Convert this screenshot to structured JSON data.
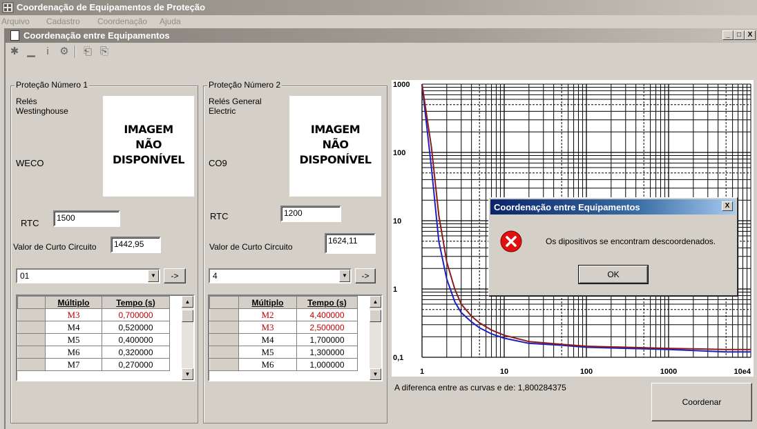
{
  "app": {
    "title": "Coordenação de Equipamentos de Proteção"
  },
  "menu": [
    "Arquivo",
    "Cadastro",
    "Coordenação",
    "Ajuda"
  ],
  "child": {
    "title": "Coordenação entre Equipamentos",
    "buttons": [
      "_",
      "□",
      "X"
    ]
  },
  "protection1": {
    "legend": "Proteção Número 1",
    "manufacturer": "Relés Westinghouse",
    "model": "WECO",
    "image_text_line1": "IMAGEM",
    "image_text_line2": "NÃO DISPONÍVEL",
    "rtc_label": "RTC",
    "rtc_value": "1500",
    "short_circuit_label": "Valor de Curto Circuito",
    "short_circuit_value": "1442,95",
    "combo_value": "01",
    "go_button": "->",
    "table": {
      "headers": [
        "Múltiplo",
        "Tempo (s)"
      ],
      "rows": [
        {
          "m": "M3",
          "t": "0,700000",
          "highlight": true
        },
        {
          "m": "M4",
          "t": "0,520000",
          "highlight": false
        },
        {
          "m": "M5",
          "t": "0,400000",
          "highlight": false
        },
        {
          "m": "M6",
          "t": "0,320000",
          "highlight": false
        },
        {
          "m": "M7",
          "t": "0,270000",
          "highlight": false
        }
      ]
    }
  },
  "protection2": {
    "legend": "Proteção Número 2",
    "manufacturer": "Relés General Electric",
    "model": "CO9",
    "image_text_line1": "IMAGEM",
    "image_text_line2": "NÃO DISPONÍVEL",
    "rtc_label": "RTC",
    "rtc_value": "1200",
    "short_circuit_label": "Valor de Curto Circuito",
    "short_circuit_value": "1624,11",
    "combo_value": "4",
    "go_button": "->",
    "table": {
      "headers": [
        "Múltiplo",
        "Tempo (s)"
      ],
      "rows": [
        {
          "m": "M2",
          "t": "4,400000",
          "highlight": true
        },
        {
          "m": "M3",
          "t": "2,500000",
          "highlight": true
        },
        {
          "m": "M4",
          "t": "1,700000",
          "highlight": false
        },
        {
          "m": "M5",
          "t": "1,300000",
          "highlight": false
        },
        {
          "m": "M6",
          "t": "1,000000",
          "highlight": false
        }
      ]
    }
  },
  "status_text": "A diferenca entre as curvas e de: 1,800284375",
  "coordinate_button": "Coordenar",
  "dialog": {
    "title": "Coordenação entre Equipamentos",
    "message": "Os dipositivos se encontram descoordenados.",
    "ok": "OK",
    "close": "X"
  },
  "chart_data": {
    "type": "line",
    "scale": "log-log",
    "x_ticks": [
      "1",
      "10",
      "100",
      "1000",
      "10e4"
    ],
    "y_ticks": [
      "1000",
      "100",
      "10",
      "1",
      "0,1"
    ],
    "xlim": [
      1,
      10000
    ],
    "ylim": [
      0.1,
      1000
    ],
    "grid": true,
    "series": [
      {
        "color": "#1f1fbf",
        "x": [
          1,
          1.3,
          1.6,
          2,
          2.5,
          3,
          4,
          5,
          7,
          10,
          20,
          50,
          100,
          1000,
          5000,
          10000
        ],
        "y": [
          1000,
          60,
          5,
          1.4,
          0.65,
          0.45,
          0.33,
          0.27,
          0.22,
          0.19,
          0.16,
          0.15,
          0.14,
          0.13,
          0.12,
          0.12
        ]
      },
      {
        "color": "#8b1a1a",
        "x": [
          1,
          1.3,
          1.6,
          2,
          2.5,
          3,
          4,
          5,
          7,
          10,
          20,
          50,
          100,
          1000,
          5000,
          10000
        ],
        "y": [
          1000,
          120,
          12,
          2.5,
          1.0,
          0.6,
          0.4,
          0.32,
          0.25,
          0.21,
          0.17,
          0.155,
          0.145,
          0.135,
          0.13,
          0.13
        ]
      }
    ]
  }
}
